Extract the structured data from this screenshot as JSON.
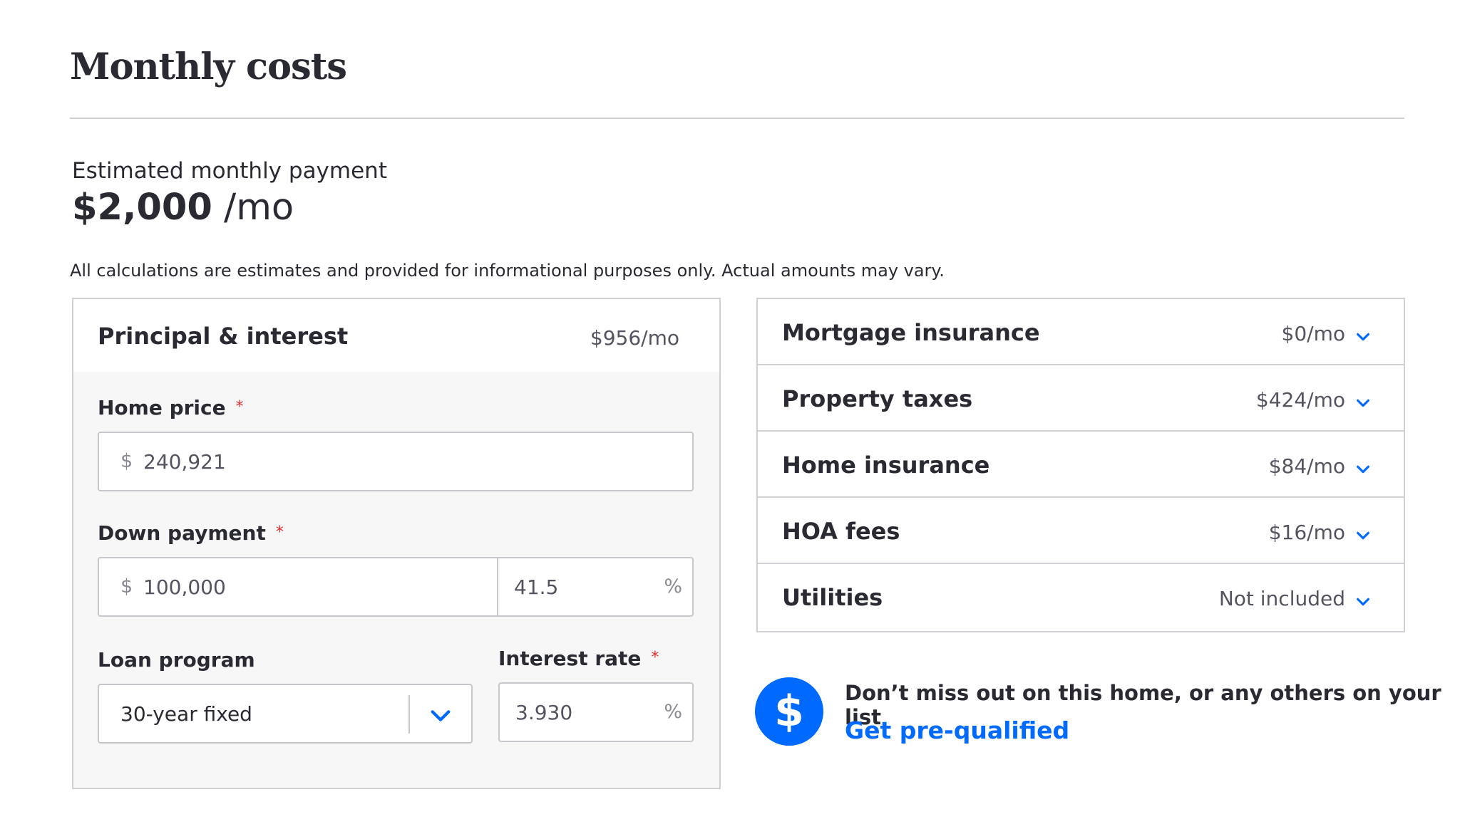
{
  "page": {
    "title": "Monthly costs"
  },
  "estimate": {
    "label": "Estimated monthly payment",
    "amount": "$2,000",
    "unit": "/mo",
    "disclaimer": "All calculations are estimates and provided for informational purposes only. Actual amounts may vary."
  },
  "principal": {
    "label": "Principal & interest",
    "value": "$956/mo",
    "home_price": {
      "label": "Home price",
      "required_mark": "*",
      "prefix": "$",
      "value": "240,921"
    },
    "down_payment": {
      "label": "Down payment",
      "required_mark": "*",
      "prefix": "$",
      "value": "100,000",
      "percent_value": "41.5",
      "percent_suffix": "%"
    },
    "loan_program": {
      "label": "Loan program",
      "selected": "30-year fixed"
    },
    "interest_rate": {
      "label": "Interest rate",
      "required_mark": "*",
      "value": "3.930",
      "suffix": "%"
    }
  },
  "costs": [
    {
      "label": "Mortgage insurance",
      "value": "$0/mo"
    },
    {
      "label": "Property taxes",
      "value": "$424/mo"
    },
    {
      "label": "Home insurance",
      "value": "$84/mo"
    },
    {
      "label": "HOA fees",
      "value": "$16/mo"
    },
    {
      "label": "Utilities",
      "value": "Not included"
    }
  ],
  "promo": {
    "icon": "dollar-icon",
    "icon_glyph": "$",
    "text": "Don’t miss out on this home, or any others on your list",
    "link": "Get pre-qualified"
  },
  "colors": {
    "accent": "#006aff",
    "required": "#e22c2c",
    "text": "#2a2a33",
    "border": "#d1d1d5",
    "panel_bg": "#f7f7f8"
  }
}
